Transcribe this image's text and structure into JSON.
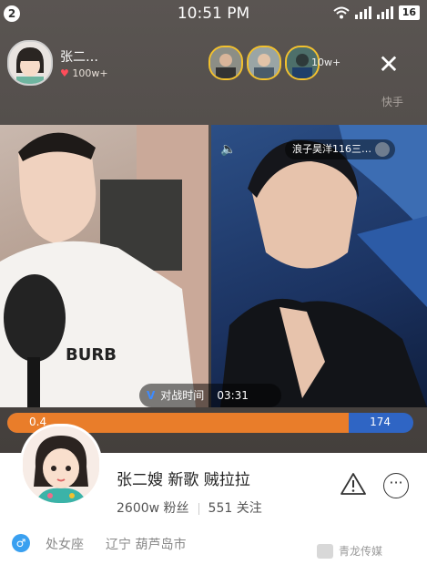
{
  "status_bar": {
    "notification_count": "2",
    "time": "10:51 PM",
    "battery": "16"
  },
  "host": {
    "name": "张二…",
    "likes": "100w+"
  },
  "viewers": {
    "count": "10w+"
  },
  "quick_label": "快手",
  "pk": {
    "opponent_tag": "浪子昊洋116三…",
    "timer_label": "对战时间",
    "timer_value": "03:31",
    "score_left": "0.4",
    "score_right": "174",
    "left_share": 0.84
  },
  "profile": {
    "name": "张二嫂 新歌 贼拉拉",
    "fans": "2600w 粉丝",
    "following": "551 关注",
    "constellation": "处女座",
    "location": "辽宁 葫芦岛市"
  },
  "watermark": "青龙传媒",
  "icons": [
    "notification-badge",
    "wifi-icon",
    "signal-icon",
    "battery-icon",
    "heart-icon",
    "close-icon",
    "speaker-icon",
    "pk-icon",
    "report-icon",
    "more-icon",
    "male-icon"
  ],
  "colors": {
    "score_left": "#e97d2a",
    "score_right": "#2f65c4",
    "gender": "#3aa0f0"
  }
}
